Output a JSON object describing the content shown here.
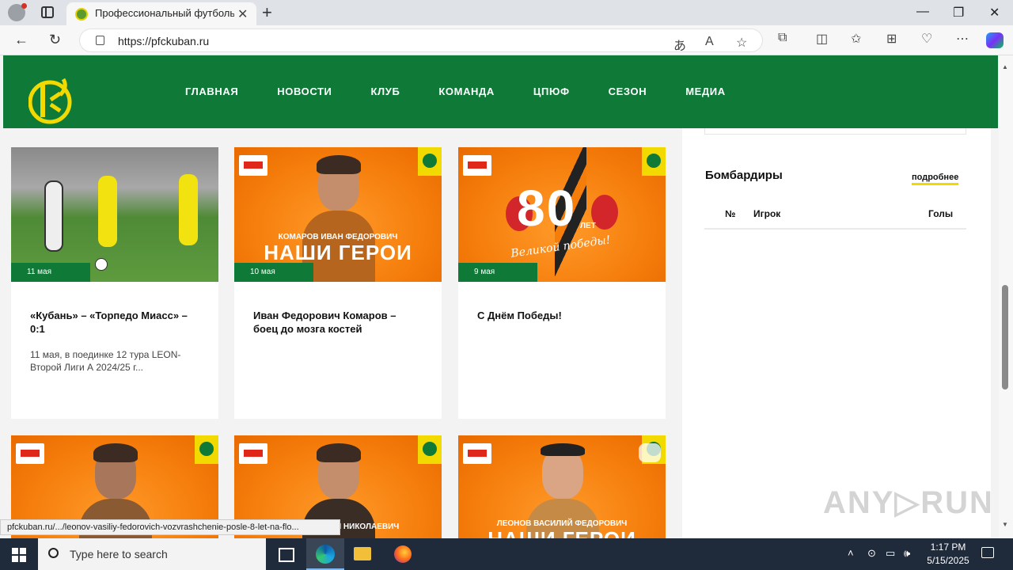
{
  "browser": {
    "tab_title": "Профессиональный футбольный клуб Кубань",
    "tab_close": "✕",
    "new_tab": "+",
    "url": "https://pfckuban.ru",
    "controls": {
      "minimize": "—",
      "maximize": "❐",
      "close": "✕"
    }
  },
  "nav": [
    "ГЛАВНАЯ",
    "НОВОСТИ",
    "КЛУБ",
    "КОМАНДА",
    "ЦПЮФ",
    "СЕЗОН",
    "МЕДИА"
  ],
  "news": [
    {
      "date": "11 мая",
      "title": "«Кубань» – «Торпедо Миасс» – 0:1",
      "excerpt": "11 мая, в поединке 12 тура LEON-Второй Лиги А 2024/25 г..."
    },
    {
      "date": "10 мая",
      "title": "Иван Федорович Комаров – боец до мозга костей",
      "hero_sub": "КОМАРОВ ИВАН ФЕДОРОВИЧ",
      "hero_main": "НАШИ ГЕРОИ"
    },
    {
      "date": "9 мая",
      "title": "С Днём Победы!",
      "hero_big": "80",
      "hero_small": "ЛЕТ",
      "hero_script": "Великой победы!"
    }
  ],
  "news_row2": [
    {
      "hero_sub": ""
    },
    {
      "hero_sub": "ЛАЙ НИКОЛАЕВИЧ"
    },
    {
      "hero_sub": "ЛЕОНОВ ВАСИЛИЙ ФЕДОРОВИЧ",
      "hero_main": "НАШИ ГЕРОИ"
    }
  ],
  "sidebar": {
    "title": "Бомбардиры",
    "more": "подробнее",
    "headers": {
      "num": "№",
      "player": "Игрок",
      "goals": "Голы"
    }
  },
  "status_url": "pfckuban.ru/.../leonov-vasiliy-fedorovich-vozvrashchenie-posle-8-let-na-flo...",
  "watermark": "ANY▷RUN",
  "taskbar": {
    "search_placeholder": "Type here to search",
    "time": "1:17 PM",
    "date": "5/15/2025"
  },
  "colors": {
    "brand_green": "#0f7a38",
    "brand_yellow": "#f2d900",
    "hero_orange": "#f57d0b"
  }
}
